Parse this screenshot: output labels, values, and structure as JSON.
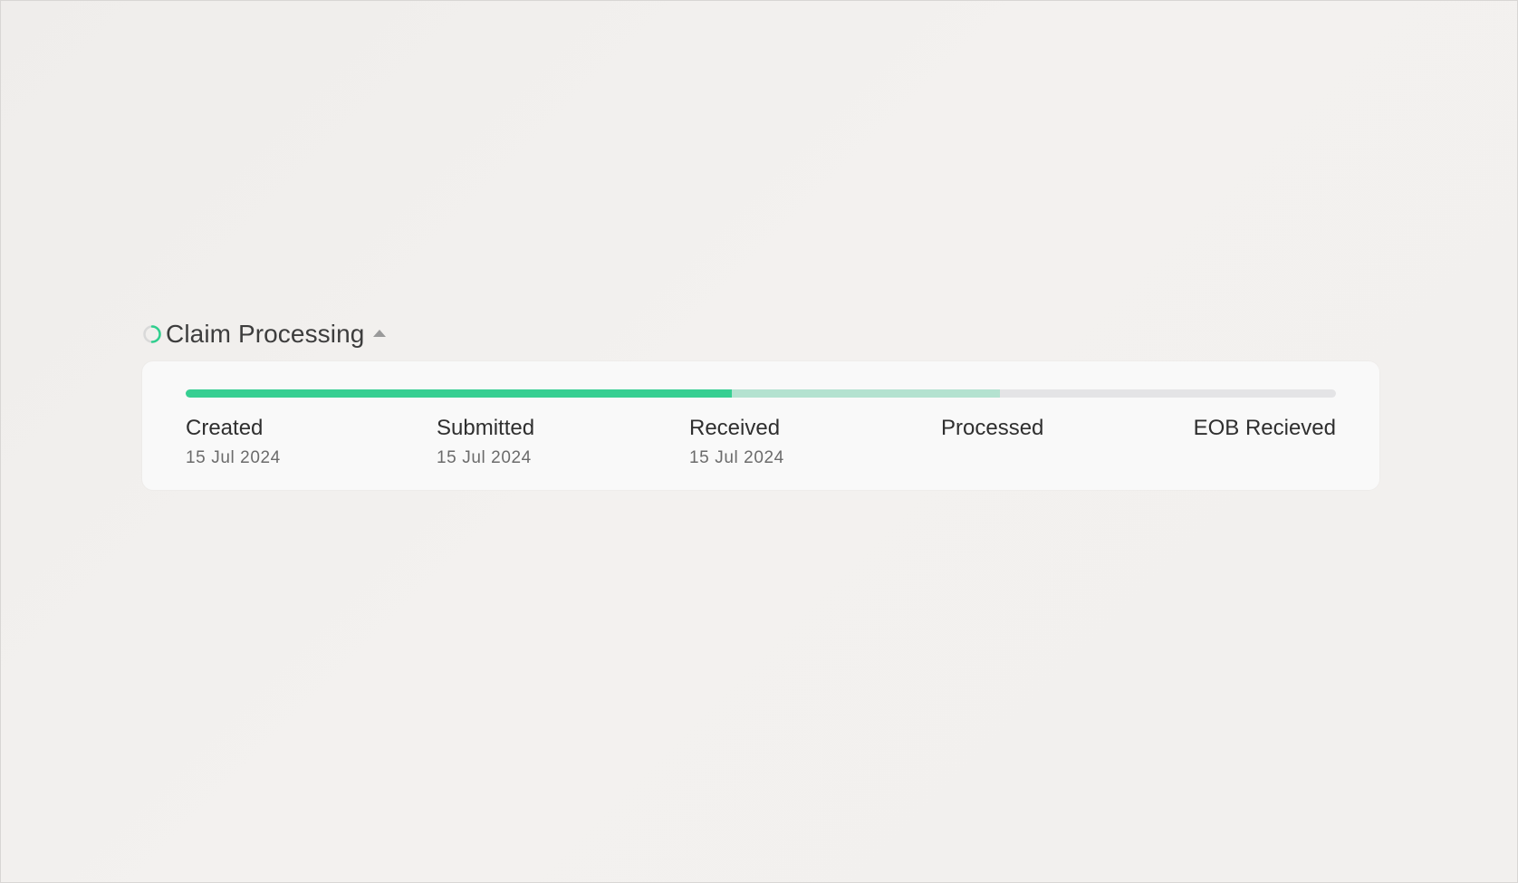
{
  "section": {
    "title": "Claim Processing",
    "status_icon": "loading-spinner-icon",
    "toggle_icon": "caret-up-icon"
  },
  "progress": {
    "completed_fraction": 0.475,
    "in_progress_fraction": 0.708,
    "colors": {
      "completed": "#36cf92",
      "in_progress": "#b4e2d0",
      "remaining": "#e4e4e6"
    }
  },
  "steps": [
    {
      "label": "Created",
      "date": "15 Jul 2024"
    },
    {
      "label": "Submitted",
      "date": "15 Jul 2024"
    },
    {
      "label": "Received",
      "date": "15 Jul 2024"
    },
    {
      "label": "Processed",
      "date": ""
    },
    {
      "label": "EOB Recieved",
      "date": ""
    }
  ]
}
